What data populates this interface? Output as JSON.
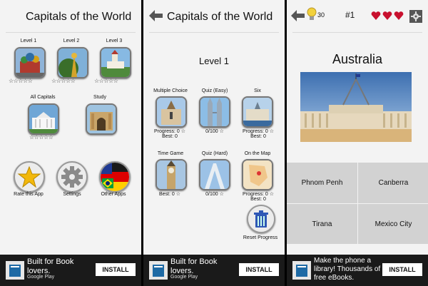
{
  "panel1": {
    "title": "Capitals of the World",
    "levels": [
      {
        "label": "Level 1",
        "stars": "☆☆☆☆☆"
      },
      {
        "label": "Level 2",
        "stars": "☆☆☆☆☆"
      },
      {
        "label": "Level 3",
        "stars": "☆☆☆☆☆"
      }
    ],
    "all_capitals": {
      "label": "All Capitals",
      "stars": "☆☆☆☆☆"
    },
    "study": {
      "label": "Study"
    },
    "rate": {
      "label": "Rate this App"
    },
    "settings": {
      "label": "Settings"
    },
    "other_apps": {
      "label": "Other Apps"
    },
    "ad": {
      "headline": "Built for Book lovers.",
      "store": "Google Play",
      "button": "INSTALL"
    }
  },
  "panel2": {
    "title": "Capitals of the World",
    "level": "Level 1",
    "modes": [
      {
        "label": "Multiple Choice",
        "progress": "Progress: 0 ☆",
        "best": "Best: 0"
      },
      {
        "label": "Quiz (Easy)",
        "progress": "0/100 ☆",
        "best": ""
      },
      {
        "label": "Six",
        "progress": "Progress: 0 ☆",
        "best": "Best: 0"
      },
      {
        "label": "Time Game",
        "progress": "Best: 0 ☆",
        "best": ""
      },
      {
        "label": "Quiz (Hard)",
        "progress": "0/100 ☆",
        "best": ""
      },
      {
        "label": "On the Map",
        "progress": "Progress: 0 ☆",
        "best": "Best: 0"
      }
    ],
    "reset": "Reset Progress",
    "ad": {
      "headline": "Built for Book lovers.",
      "store": "Google Play",
      "button": "INSTALL"
    }
  },
  "panel3": {
    "hints": "30",
    "number": "#1",
    "question": "Australia",
    "answers": [
      "Phnom Penh",
      "Canberra",
      "Tirana",
      "Mexico City"
    ],
    "ad": {
      "headline": "Make the phone a library! Thousands of free eBooks.",
      "button": "INSTALL"
    },
    "colors": {
      "heart": "#c8102e",
      "bulb": "#f2d13b"
    }
  }
}
